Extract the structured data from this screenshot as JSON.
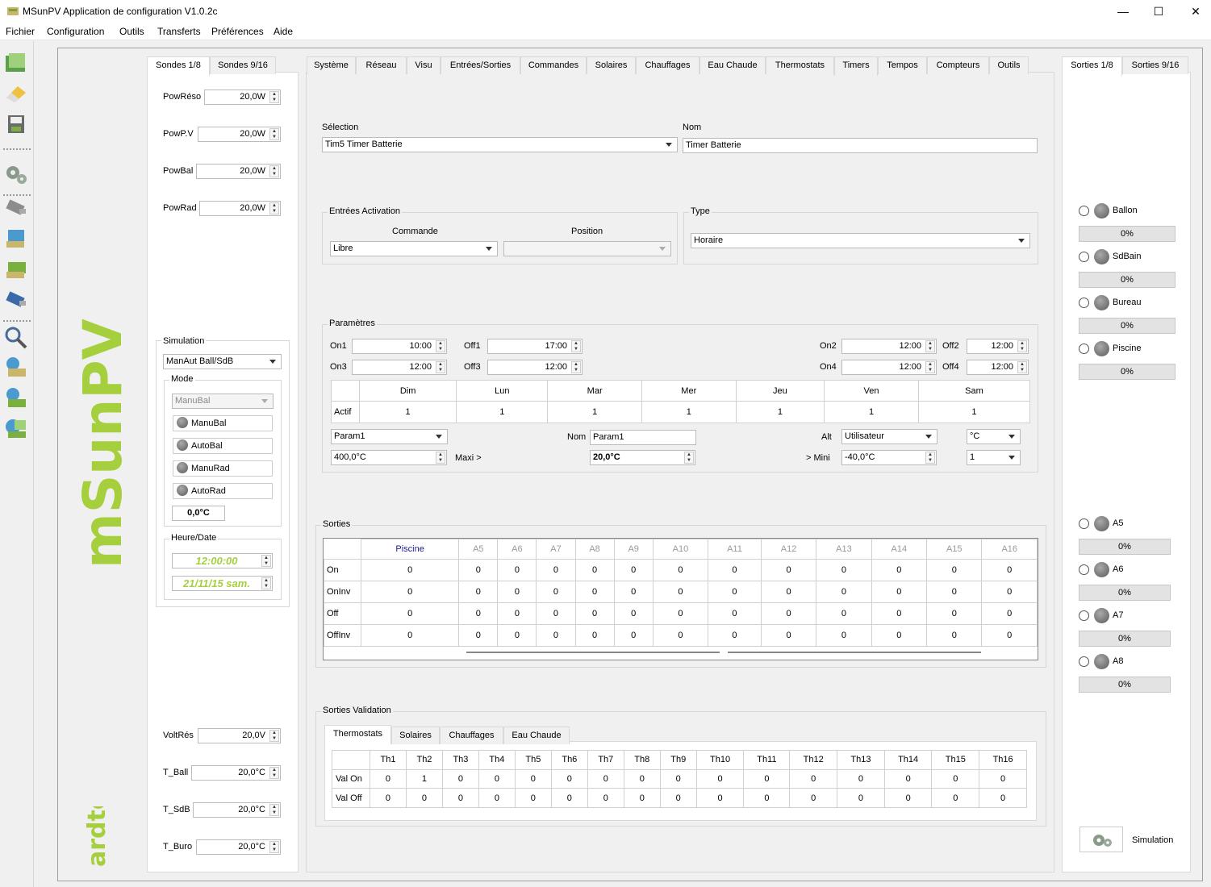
{
  "window": {
    "title": "MSunPV Application de configuration V1.0.2c",
    "minimize": "—",
    "maximize": "☐",
    "close": "✕"
  },
  "menu": [
    "Fichier",
    "Configuration",
    "Outils",
    "Transferts",
    "Préférences",
    "Aide"
  ],
  "left_tabs": {
    "tab1": "Sondes 1/8",
    "tab2": "Sondes 9/16"
  },
  "sondes_top": [
    {
      "label": "PowRéso",
      "value": "20,0W"
    },
    {
      "label": "PowP.V",
      "value": "20,0W"
    },
    {
      "label": "PowBal",
      "value": "20,0W"
    },
    {
      "label": "PowRad",
      "value": "20,0W"
    }
  ],
  "simulation": {
    "title": "Simulation",
    "mode_select": "ManAut Ball/SdB",
    "mode_title": "Mode",
    "mode_combo": "ManuBal",
    "buttons": [
      "ManuBal",
      "AutoBal",
      "ManuRad",
      "AutoRad"
    ],
    "temp": "0,0°C",
    "heure_title": "Heure/Date",
    "time": "12:00:00",
    "date": "21/11/15 sam."
  },
  "sondes_bottom": [
    {
      "label": "VoltRés",
      "value": "20,0V"
    },
    {
      "label": "T_Ball",
      "value": "20,0°C"
    },
    {
      "label": "T_SdB",
      "value": "20,0°C"
    },
    {
      "label": "T_Buro",
      "value": "20,0°C"
    }
  ],
  "main_tabs": [
    "Système",
    "Réseau",
    "Visu",
    "Entrées/Sorties",
    "Commandes",
    "Solaires",
    "Chauffages",
    "Eau Chaude",
    "Thermostats",
    "Timers",
    "Tempos",
    "Compteurs",
    "Outils"
  ],
  "selection": {
    "label": "Sélection",
    "value": "Tim5 Timer Batterie",
    "nom_label": "Nom",
    "nom_value": "Timer Batterie"
  },
  "activation": {
    "title": "Entrées Activation",
    "commande_label": "Commande",
    "commande_value": "Libre",
    "position_label": "Position",
    "position_value": ""
  },
  "type": {
    "title": "Type",
    "value": "Horaire"
  },
  "params": {
    "title": "Paramètres",
    "on1_label": "On1",
    "on1": "10:00",
    "off1_label": "Off1",
    "off1": "17:00",
    "on2_label": "On2",
    "on2": "12:00",
    "off2_label": "Off2",
    "off2": "12:00",
    "on3_label": "On3",
    "on3": "12:00",
    "off3_label": "Off3",
    "off3": "12:00",
    "on4_label": "On4",
    "on4": "12:00",
    "off4_label": "Off4",
    "off4": "12:00",
    "days": [
      "Dim",
      "Lun",
      "Mar",
      "Mer",
      "Jeu",
      "Ven",
      "Sam"
    ],
    "actif_label": "Actif",
    "actif": [
      "1",
      "1",
      "1",
      "1",
      "1",
      "1",
      "1"
    ],
    "param_select": "Param1",
    "nom_label": "Nom",
    "nom_value": "Param1",
    "alt_label": "Alt",
    "alt_value": "Utilisateur",
    "unit_value": "°C",
    "min_value": "400,0°C",
    "maxi_label": "Maxi >",
    "mid_value": "20,0°C",
    "mini_label": "> Mini",
    "max_value": "-40,0°C",
    "count_value": "1"
  },
  "sorties": {
    "title": "Sorties",
    "columns": [
      "Piscine",
      "A5",
      "A6",
      "A7",
      "A8",
      "A9",
      "A10",
      "A11",
      "A12",
      "A13",
      "A14",
      "A15",
      "A16"
    ],
    "rows": [
      {
        "label": "On",
        "values": [
          "0",
          "0",
          "0",
          "0",
          "0",
          "0",
          "0",
          "0",
          "0",
          "0",
          "0",
          "0",
          "0"
        ]
      },
      {
        "label": "OnInv",
        "values": [
          "0",
          "0",
          "0",
          "0",
          "0",
          "0",
          "0",
          "0",
          "0",
          "0",
          "0",
          "0",
          "0"
        ]
      },
      {
        "label": "Off",
        "values": [
          "0",
          "0",
          "0",
          "0",
          "0",
          "0",
          "0",
          "0",
          "0",
          "0",
          "0",
          "0",
          "0"
        ]
      },
      {
        "label": "OffInv",
        "values": [
          "0",
          "0",
          "0",
          "0",
          "0",
          "0",
          "0",
          "0",
          "0",
          "0",
          "0",
          "0",
          "0"
        ]
      }
    ]
  },
  "validation": {
    "title": "Sorties Validation",
    "tabs": [
      "Thermostats",
      "Solaires",
      "Chauffages",
      "Eau Chaude"
    ],
    "columns": [
      "Th1",
      "Th2",
      "Th3",
      "Th4",
      "Th5",
      "Th6",
      "Th7",
      "Th8",
      "Th9",
      "Th10",
      "Th11",
      "Th12",
      "Th13",
      "Th14",
      "Th15",
      "Th16"
    ],
    "rows": [
      {
        "label": "Val On",
        "values": [
          "0",
          "1",
          "0",
          "0",
          "0",
          "0",
          "0",
          "0",
          "0",
          "0",
          "0",
          "0",
          "0",
          "0",
          "0",
          "0"
        ]
      },
      {
        "label": "Val Off",
        "values": [
          "0",
          "0",
          "0",
          "0",
          "0",
          "0",
          "0",
          "0",
          "0",
          "0",
          "0",
          "0",
          "0",
          "0",
          "0",
          "0"
        ]
      }
    ]
  },
  "right_tabs": {
    "tab1": "Sorties 1/8",
    "tab2": "Sorties 9/16"
  },
  "outputs_top": [
    {
      "name": "Ballon",
      "pct": "0%"
    },
    {
      "name": "SdBain",
      "pct": "0%"
    },
    {
      "name": "Bureau",
      "pct": "0%"
    },
    {
      "name": "Piscine",
      "pct": "0%"
    }
  ],
  "outputs_bottom": [
    {
      "name": "A5",
      "pct": "0%"
    },
    {
      "name": "A6",
      "pct": "0%"
    },
    {
      "name": "A7",
      "pct": "0%"
    },
    {
      "name": "A8",
      "pct": "0%"
    }
  ],
  "sim_button": "Simulation",
  "logo": {
    "text": "mSunPV",
    "brand": "ardtek"
  },
  "colors": {
    "accent_green": "#a6cf3e",
    "selected_col": "#1a1a8c"
  }
}
